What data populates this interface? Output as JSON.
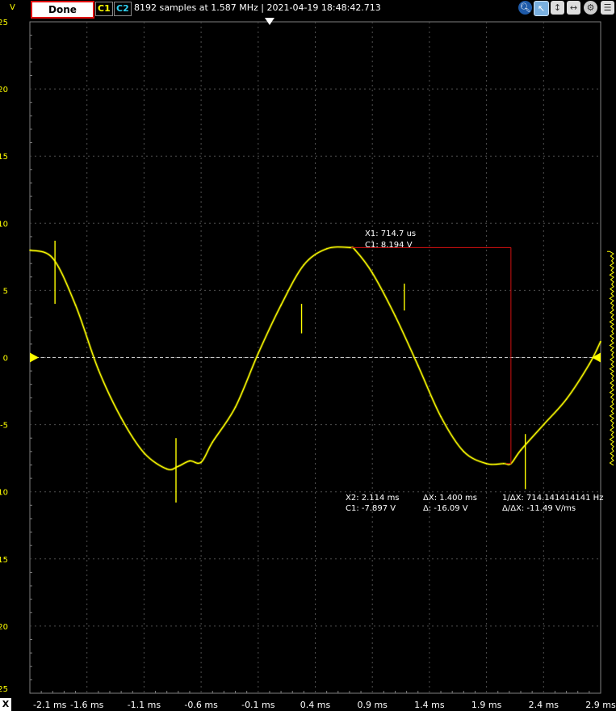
{
  "toolbar": {
    "status_label": "Done",
    "channel1_label": "C1",
    "channel2_label": "C2",
    "info_text": "8192 samples at 1.587 MHz | 2021-04-19 18:48:42.713",
    "y_unit": "V",
    "x_axis_button": "X",
    "colors": {
      "channel1": "#ffff00",
      "channel2": "#30d0f0",
      "status_border": "#e01010"
    },
    "icons": [
      "zoom-icon",
      "cursor-icon",
      "ruler-icon",
      "pan-icon",
      "settings-icon",
      "menu-icon"
    ]
  },
  "chart_data": {
    "type": "line",
    "title": "",
    "xlabel": "",
    "ylabel": "V",
    "xlim": [
      -2.1,
      2.9
    ],
    "ylim": [
      -25,
      25
    ],
    "x_ticks": [
      "-2.1 ms",
      "-1.6 ms",
      "-1.1 ms",
      "-0.6 ms",
      "-0.1 ms",
      "0.4 ms",
      "0.9 ms",
      "1.4 ms",
      "1.9 ms",
      "2.4 ms",
      "2.9 ms"
    ],
    "y_ticks": [
      "25",
      "20",
      "15",
      "10",
      "5",
      "0",
      "-5",
      "-10",
      "-15",
      "-20",
      "-25"
    ],
    "grid": true,
    "series": [
      {
        "name": "C1",
        "color": "#ffff00",
        "x": [
          -2.1,
          -1.9,
          -1.7,
          -1.5,
          -1.3,
          -1.1,
          -0.9,
          -0.8,
          -0.7,
          -0.6,
          -0.5,
          -0.3,
          -0.1,
          0.1,
          0.3,
          0.5,
          0.7,
          0.75,
          0.9,
          1.1,
          1.3,
          1.5,
          1.7,
          1.9,
          2.05,
          2.114,
          2.2,
          2.4,
          2.6,
          2.8,
          2.9
        ],
        "values": [
          8.0,
          7.4,
          3.9,
          -0.9,
          -4.5,
          -7.1,
          -8.3,
          -8.1,
          -7.7,
          -7.8,
          -6.3,
          -3.7,
          0.3,
          3.9,
          6.9,
          8.1,
          8.19,
          8.0,
          6.3,
          3.1,
          -0.6,
          -4.4,
          -7.0,
          -7.9,
          -7.9,
          -7.897,
          -6.9,
          -5.0,
          -3.1,
          -0.5,
          1.2
        ]
      }
    ],
    "spikes": [
      {
        "x": -1.88,
        "low": 4.0,
        "high": 8.7
      },
      {
        "x": -0.82,
        "low": -10.8,
        "high": -6.0
      },
      {
        "x": 0.28,
        "low": 1.8,
        "high": 4.0
      },
      {
        "x": 1.18,
        "low": 3.5,
        "high": 5.5
      },
      {
        "x": 2.24,
        "low": -9.8,
        "high": -5.7
      }
    ],
    "trigger_level_v": 0,
    "trigger_time_ms": 0.0,
    "cursors": {
      "x1": {
        "label": "X1: 714.7 us",
        "value_label": "C1: 8.194 V",
        "t": 0.7147,
        "v": 8.194
      },
      "x2": {
        "label": "X2: 2.114 ms",
        "value_label": "C1: -7.897 V",
        "t": 2.114,
        "v": -7.897
      },
      "delta_x": "ΔX: 1.400 ms",
      "delta_v": "Δ: -16.09 V",
      "inv_delta_x": "1/ΔX: 714.141414141 Hz",
      "slope": "Δ/ΔX: -11.49 V/ms",
      "line_color": "#d01010"
    }
  }
}
